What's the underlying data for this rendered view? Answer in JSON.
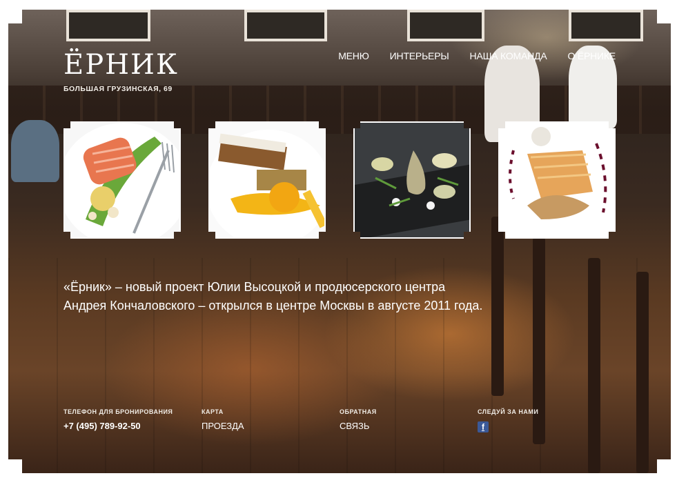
{
  "brand": {
    "logo_text": "ЁРНИК",
    "address": "БОЛЬШАЯ ГРУЗИНСКАЯ, 69"
  },
  "nav": {
    "items": [
      "МЕНЮ",
      "ИНТЕРЬЕРЫ",
      "НАША КОМАНДА",
      "О ЁРНИКЕ"
    ]
  },
  "intro": {
    "text": "«Ёрник» – новый проект Юлии Высоцкой и продюсерского центра Андрея Кончаловского – открылся в центре Москвы в августе 2011 года."
  },
  "footer": {
    "phone_label": "ТЕЛЕФОН ДЛЯ БРОНИРОВАНИЯ",
    "phone_value": "+7 (495) 789-92-50",
    "map_label": "КАРТА",
    "map_value": "ПРОЕЗДА",
    "feedback_label": "ОБРАТНАЯ",
    "feedback_value": "СВЯЗЬ",
    "follow_label": "СЛЕДУЙ ЗА НАМИ",
    "facebook_icon": "facebook-icon"
  },
  "colors": {
    "facebook_blue": "#3b5998",
    "text_white": "#ffffff"
  }
}
